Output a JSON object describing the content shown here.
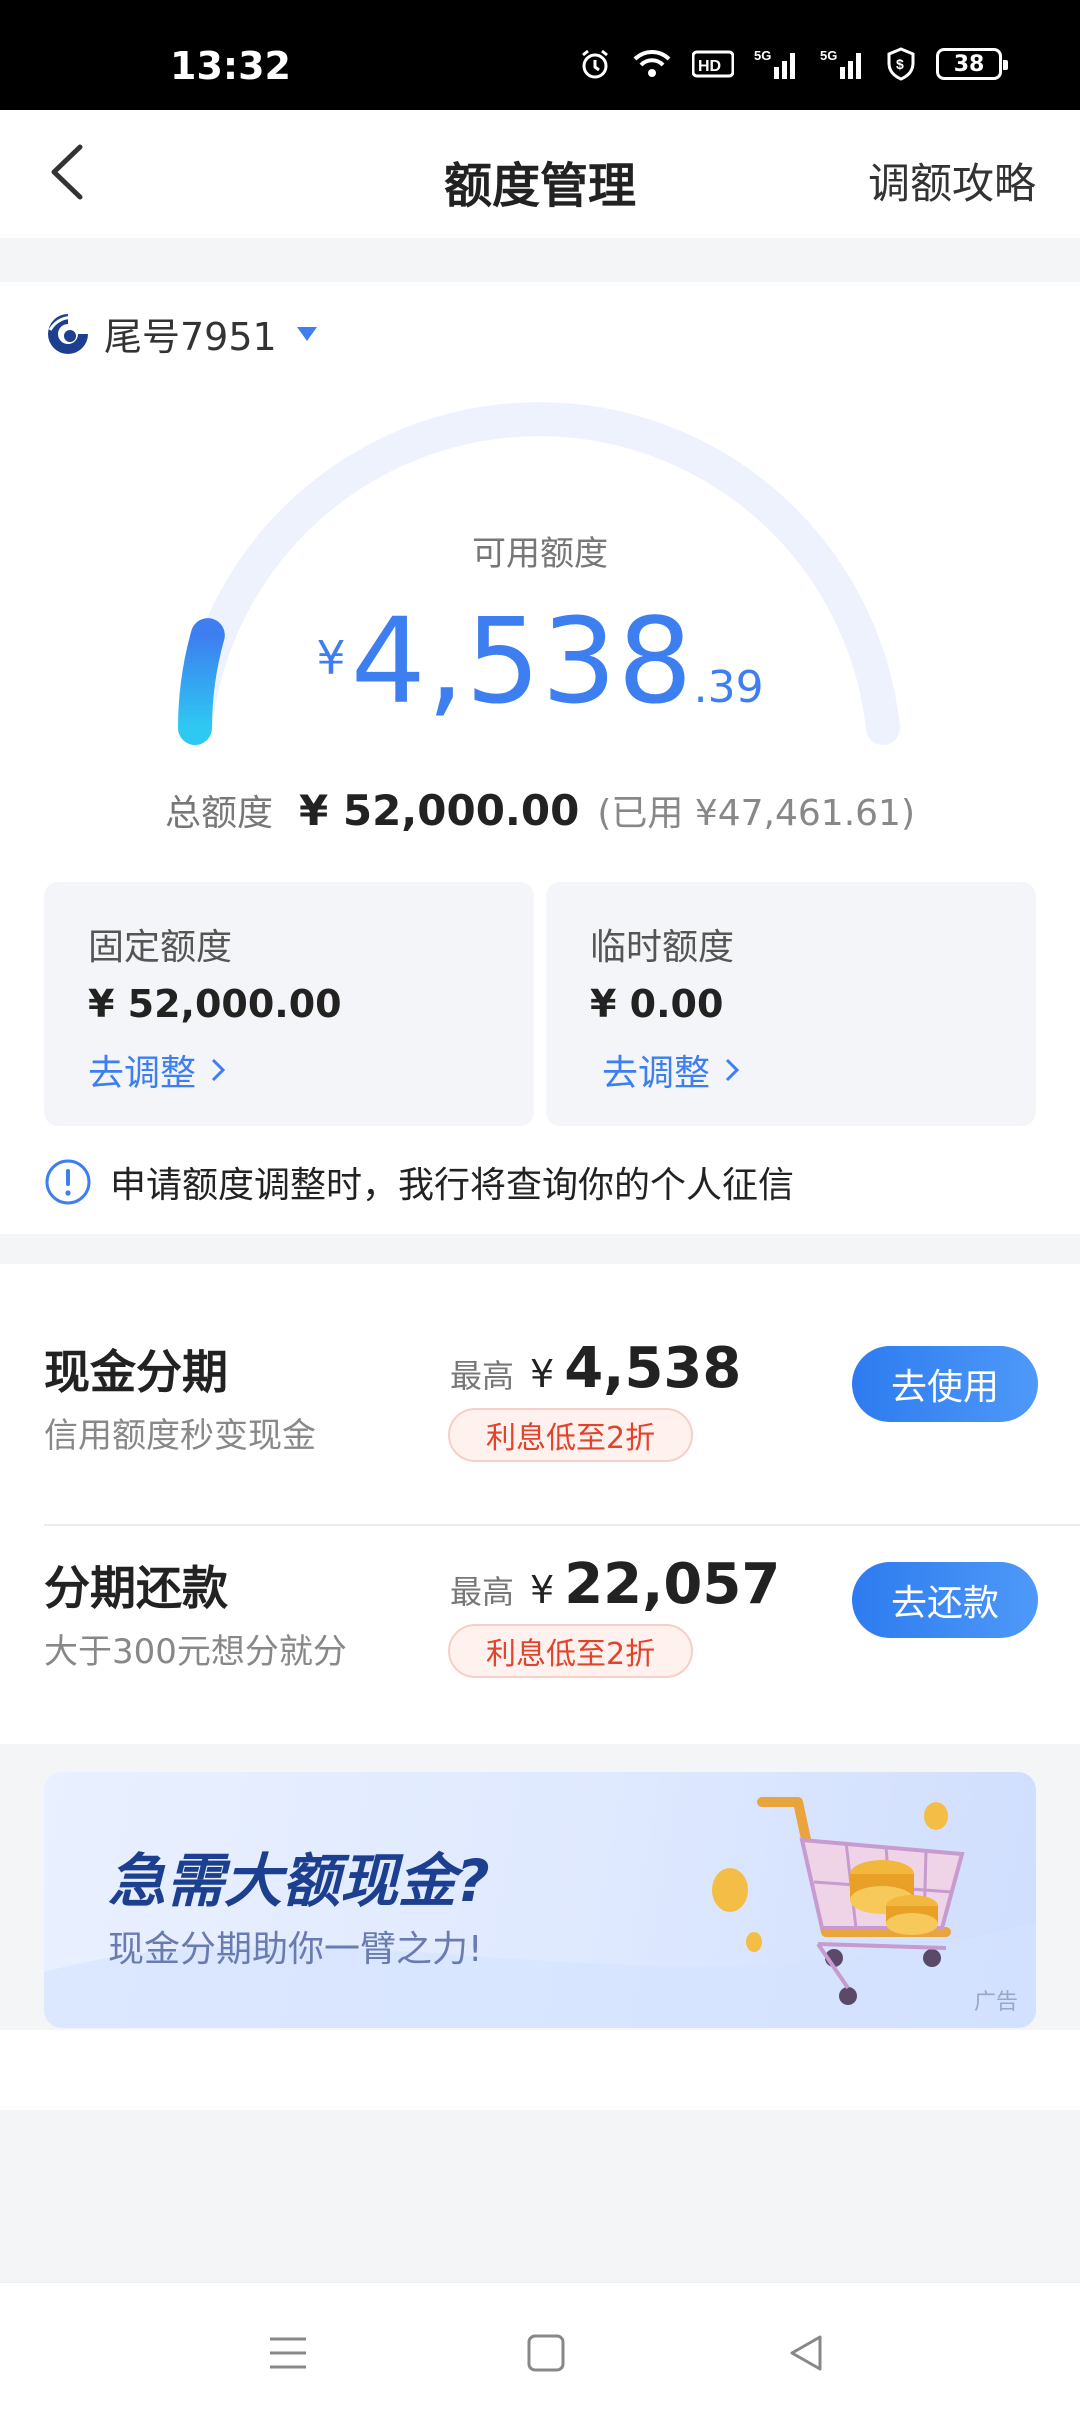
{
  "status_bar": {
    "time": "13:32",
    "battery": "38",
    "icons": [
      "alarm-icon",
      "wifi-icon",
      "hd-icon",
      "5g-signal-icon",
      "5g-signal-icon",
      "shield-icon",
      "battery-icon"
    ]
  },
  "header": {
    "title": "额度管理",
    "right_link": "调额攻略"
  },
  "account": {
    "label": "尾号7951"
  },
  "gauge": {
    "label": "可用额度",
    "currency": "¥",
    "integer": "4,538",
    "decimal": ".39",
    "available": 4538.39,
    "total": 52000.0,
    "fill_fraction": 0.087
  },
  "total": {
    "label": "总额度",
    "amount": "¥ 52,000.00",
    "used": "(已用 ¥47,461.61)"
  },
  "quotas": [
    {
      "label": "固定额度",
      "value": "¥ 52,000.00",
      "link": "去调整"
    },
    {
      "label": "临时额度",
      "value": "¥ 0.00",
      "link": "去调整"
    }
  ],
  "notice": {
    "text": "申请额度调整时，我行将查询你的个人征信"
  },
  "loans": [
    {
      "title": "现金分期",
      "subtitle": "信用额度秒变现金",
      "max_label": "最高",
      "currency": "¥",
      "value": "4,538",
      "tag": "利息低至2折",
      "button": "去使用"
    },
    {
      "title": "分期还款",
      "subtitle": "大于300元想分就分",
      "max_label": "最高",
      "currency": "¥",
      "value": "22,057",
      "tag": "利息低至2折",
      "button": "去还款"
    }
  ],
  "ad": {
    "headline": "急需大额现金?",
    "subtitle": "现金分期助你一臂之力!",
    "tag": "广告"
  },
  "colors": {
    "accent": "#3d7ef0",
    "tag_red": "#e0442d",
    "gauge_track": "#eef2fd"
  }
}
